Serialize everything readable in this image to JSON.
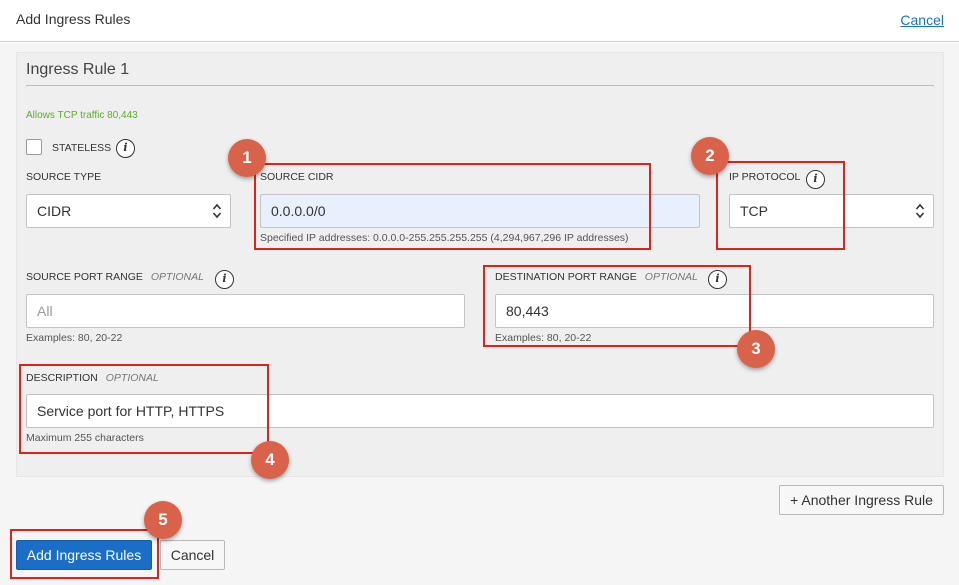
{
  "header": {
    "title": "Add Ingress Rules",
    "cancel_label": "Cancel"
  },
  "rule": {
    "title": "Ingress Rule 1",
    "summary": "Allows TCP traffic 80,443",
    "stateless_label": "STATELESS",
    "stateless_checked": false,
    "source_type": {
      "label": "SOURCE TYPE",
      "value": "CIDR"
    },
    "source_cidr": {
      "label": "SOURCE CIDR",
      "value": "0.0.0.0/0",
      "help": "Specified IP addresses: 0.0.0.0-255.255.255.255 (4,294,967,296 IP addresses)"
    },
    "ip_protocol": {
      "label": "IP PROTOCOL",
      "value": "TCP"
    },
    "source_port_range": {
      "label": "SOURCE PORT RANGE",
      "optional": "OPTIONAL",
      "placeholder": "All",
      "help": "Examples: 80, 20-22"
    },
    "destination_port_range": {
      "label": "DESTINATION PORT RANGE",
      "optional": "OPTIONAL",
      "value": "80,443",
      "help": "Examples: 80, 20-22"
    },
    "description": {
      "label": "DESCRIPTION",
      "optional": "OPTIONAL",
      "value": "Service port for HTTP, HTTPS",
      "help": "Maximum 255 characters"
    }
  },
  "another_rule_label": "+ Another Ingress Rule",
  "footer": {
    "add_label": "Add Ingress Rules",
    "cancel_label": "Cancel"
  },
  "callouts": [
    "1",
    "2",
    "3",
    "4",
    "5"
  ],
  "colors": {
    "primary": "#1a6ec7",
    "link": "#1a73c1",
    "summary_green": "#5ab028",
    "callout_badge": "#d9634a",
    "callout_border": "#d9261c",
    "cidr_field_highlight": "#e8f0fd"
  }
}
